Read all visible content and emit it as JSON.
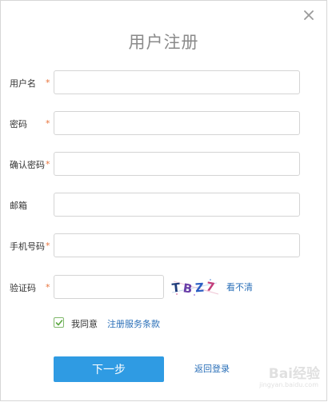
{
  "dialog": {
    "title": "用户注册",
    "close_icon": "close-icon"
  },
  "form": {
    "required_mark": "*",
    "fields": {
      "username": {
        "label": "用户名",
        "value": "",
        "required": true
      },
      "password": {
        "label": "密码",
        "value": "",
        "required": true
      },
      "confirm_password": {
        "label": "确认密码",
        "value": "",
        "required": true
      },
      "email": {
        "label": "邮箱",
        "value": "",
        "required": false
      },
      "phone": {
        "label": "手机号码",
        "value": "",
        "required": true
      },
      "captcha": {
        "label": "验证码",
        "value": "",
        "required": true
      }
    },
    "captcha_image_text": "TBZ7",
    "captcha_refresh": "看不清",
    "agree": {
      "checked": true,
      "text": "我同意",
      "terms_link": "注册服务条款"
    }
  },
  "actions": {
    "next_label": "下一步",
    "back_label": "返回登录"
  },
  "watermark": {
    "brand": "Bai经验",
    "url": "jingyan.baidu.com"
  },
  "colors": {
    "primary_button": "#2f9be3",
    "link": "#2a6fb8",
    "required": "#e8723a",
    "checkbox": "#7fb86b",
    "title": "#8a8a8a"
  }
}
